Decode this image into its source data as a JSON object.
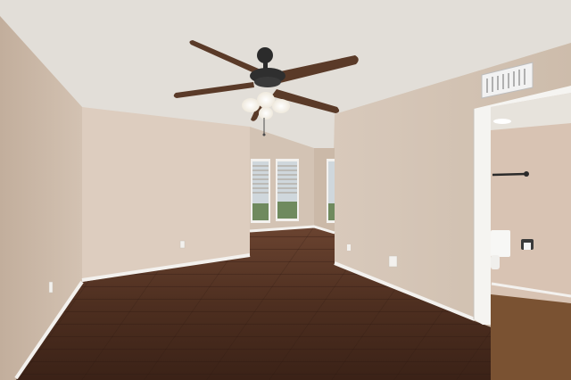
{
  "scene": {
    "subject": "empty-room-interior",
    "colors": {
      "ceiling": "#e7e4df",
      "wall_left": "#cdbbab",
      "wall_back": "#ddcdbf",
      "wall_right": "#d6c6b7",
      "floor_dark": "#3e2519",
      "floor_mid": "#5d3a27",
      "floor_light": "#7a4f35",
      "baseboard": "#f3f1ee",
      "fan_blade": "#5a3a28",
      "fan_body": "#2b2b2b",
      "light_glass": "#f7f3ea",
      "window_sky": "#cfd7dc",
      "window_blind": "#a79c91",
      "bathroom_wall": "#d8c3b3",
      "bathroom_floor": "#7a5232"
    }
  }
}
